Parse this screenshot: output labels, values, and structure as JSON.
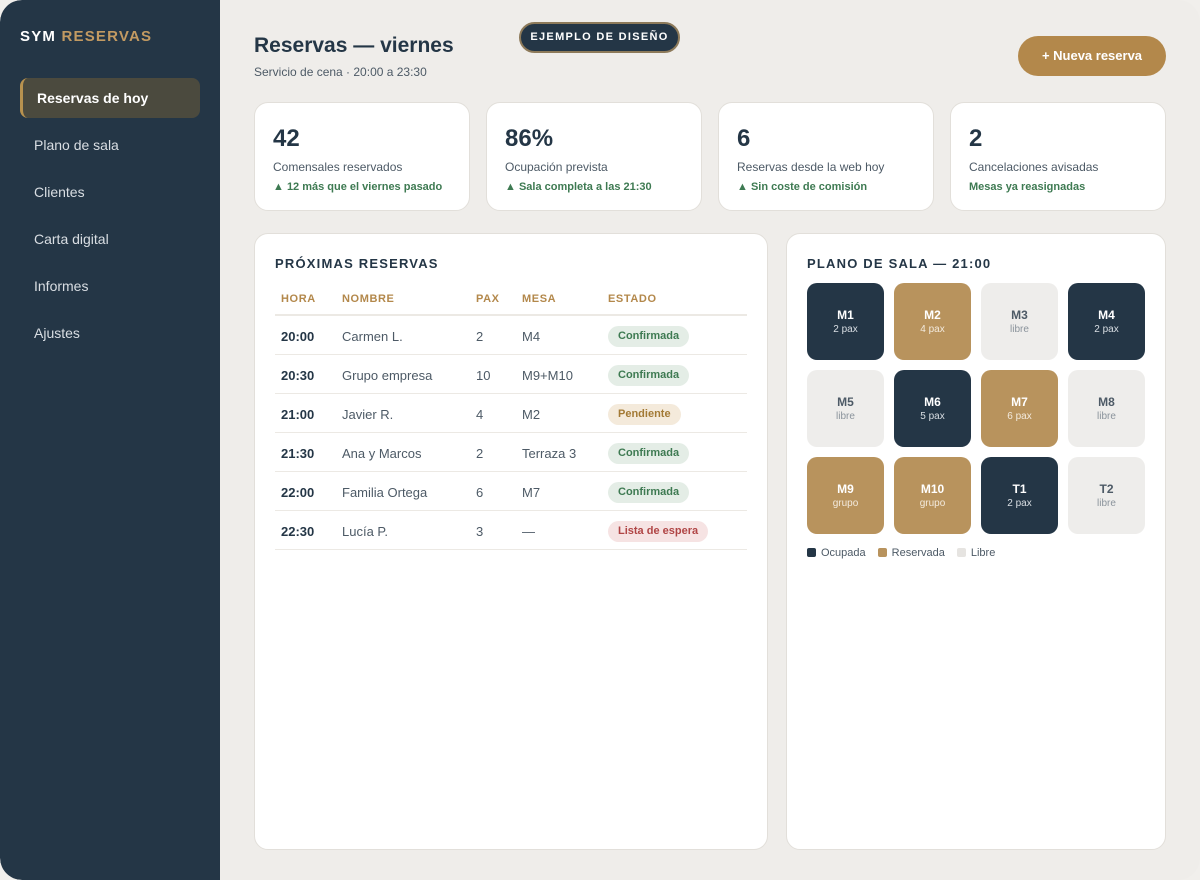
{
  "brand": {
    "part1": "SYM",
    "part2": "RESERVAS"
  },
  "nav": [
    {
      "label": "Reservas de hoy",
      "active": true
    },
    {
      "label": "Plano de sala",
      "active": false
    },
    {
      "label": "Clientes",
      "active": false
    },
    {
      "label": "Carta digital",
      "active": false
    },
    {
      "label": "Informes",
      "active": false
    },
    {
      "label": "Ajustes",
      "active": false
    }
  ],
  "header": {
    "title": "Reservas — viernes",
    "subtitle": "Servicio de cena · 20:00 a 23:30",
    "demo_label": "EJEMPLO DE DISEÑO",
    "new_button": "+ Nueva reserva"
  },
  "stats": [
    {
      "value": "42",
      "label": "Comensales reservados",
      "note": "▲ 12 más que el viernes pasado"
    },
    {
      "value": "86%",
      "label": "Ocupación prevista",
      "note": "▲ Sala completa a las 21:30"
    },
    {
      "value": "6",
      "label": "Reservas desde la web hoy",
      "note": "▲ Sin coste de comisión"
    },
    {
      "value": "2",
      "label": "Cancelaciones avisadas",
      "note": "Mesas ya reasignadas"
    }
  ],
  "reservations": {
    "title": "PRÓXIMAS RESERVAS",
    "columns": [
      "HORA",
      "NOMBRE",
      "PAX",
      "MESA",
      "ESTADO"
    ],
    "rows": [
      {
        "hora": "20:00",
        "nombre": "Carmen L.",
        "pax": "2",
        "mesa": "M4",
        "estado": "Confirmada",
        "kind": "ok"
      },
      {
        "hora": "20:30",
        "nombre": "Grupo empresa",
        "pax": "10",
        "mesa": "M9+M10",
        "estado": "Confirmada",
        "kind": "ok"
      },
      {
        "hora": "21:00",
        "nombre": "Javier R.",
        "pax": "4",
        "mesa": "M2",
        "estado": "Pendiente",
        "kind": "pend"
      },
      {
        "hora": "21:30",
        "nombre": "Ana y Marcos",
        "pax": "2",
        "mesa": "Terraza 3",
        "estado": "Confirmada",
        "kind": "ok"
      },
      {
        "hora": "22:00",
        "nombre": "Familia Ortega",
        "pax": "6",
        "mesa": "M7",
        "estado": "Confirmada",
        "kind": "ok"
      },
      {
        "hora": "22:30",
        "nombre": "Lucía P.",
        "pax": "3",
        "mesa": "—",
        "estado": "Lista de espera",
        "kind": "wait"
      }
    ]
  },
  "floor": {
    "title": "PLANO DE SALA — 21:00",
    "tables": [
      {
        "name": "M1",
        "sub": "2 pax",
        "status": "occ"
      },
      {
        "name": "M2",
        "sub": "4 pax",
        "status": "res"
      },
      {
        "name": "M3",
        "sub": "libre",
        "status": "free"
      },
      {
        "name": "M4",
        "sub": "2 pax",
        "status": "occ"
      },
      {
        "name": "M5",
        "sub": "libre",
        "status": "free"
      },
      {
        "name": "M6",
        "sub": "5 pax",
        "status": "occ"
      },
      {
        "name": "M7",
        "sub": "6 pax",
        "status": "res"
      },
      {
        "name": "M8",
        "sub": "libre",
        "status": "free"
      },
      {
        "name": "M9",
        "sub": "grupo",
        "status": "res"
      },
      {
        "name": "M10",
        "sub": "grupo",
        "status": "res"
      },
      {
        "name": "T1",
        "sub": "2 pax",
        "status": "occ"
      },
      {
        "name": "T2",
        "sub": "libre",
        "status": "free"
      }
    ],
    "legend": [
      {
        "label": "Ocupada",
        "color": "#243646"
      },
      {
        "label": "Reservada",
        "color": "#b8935d"
      },
      {
        "label": "Libre",
        "color": "#e6e4e1"
      }
    ]
  }
}
